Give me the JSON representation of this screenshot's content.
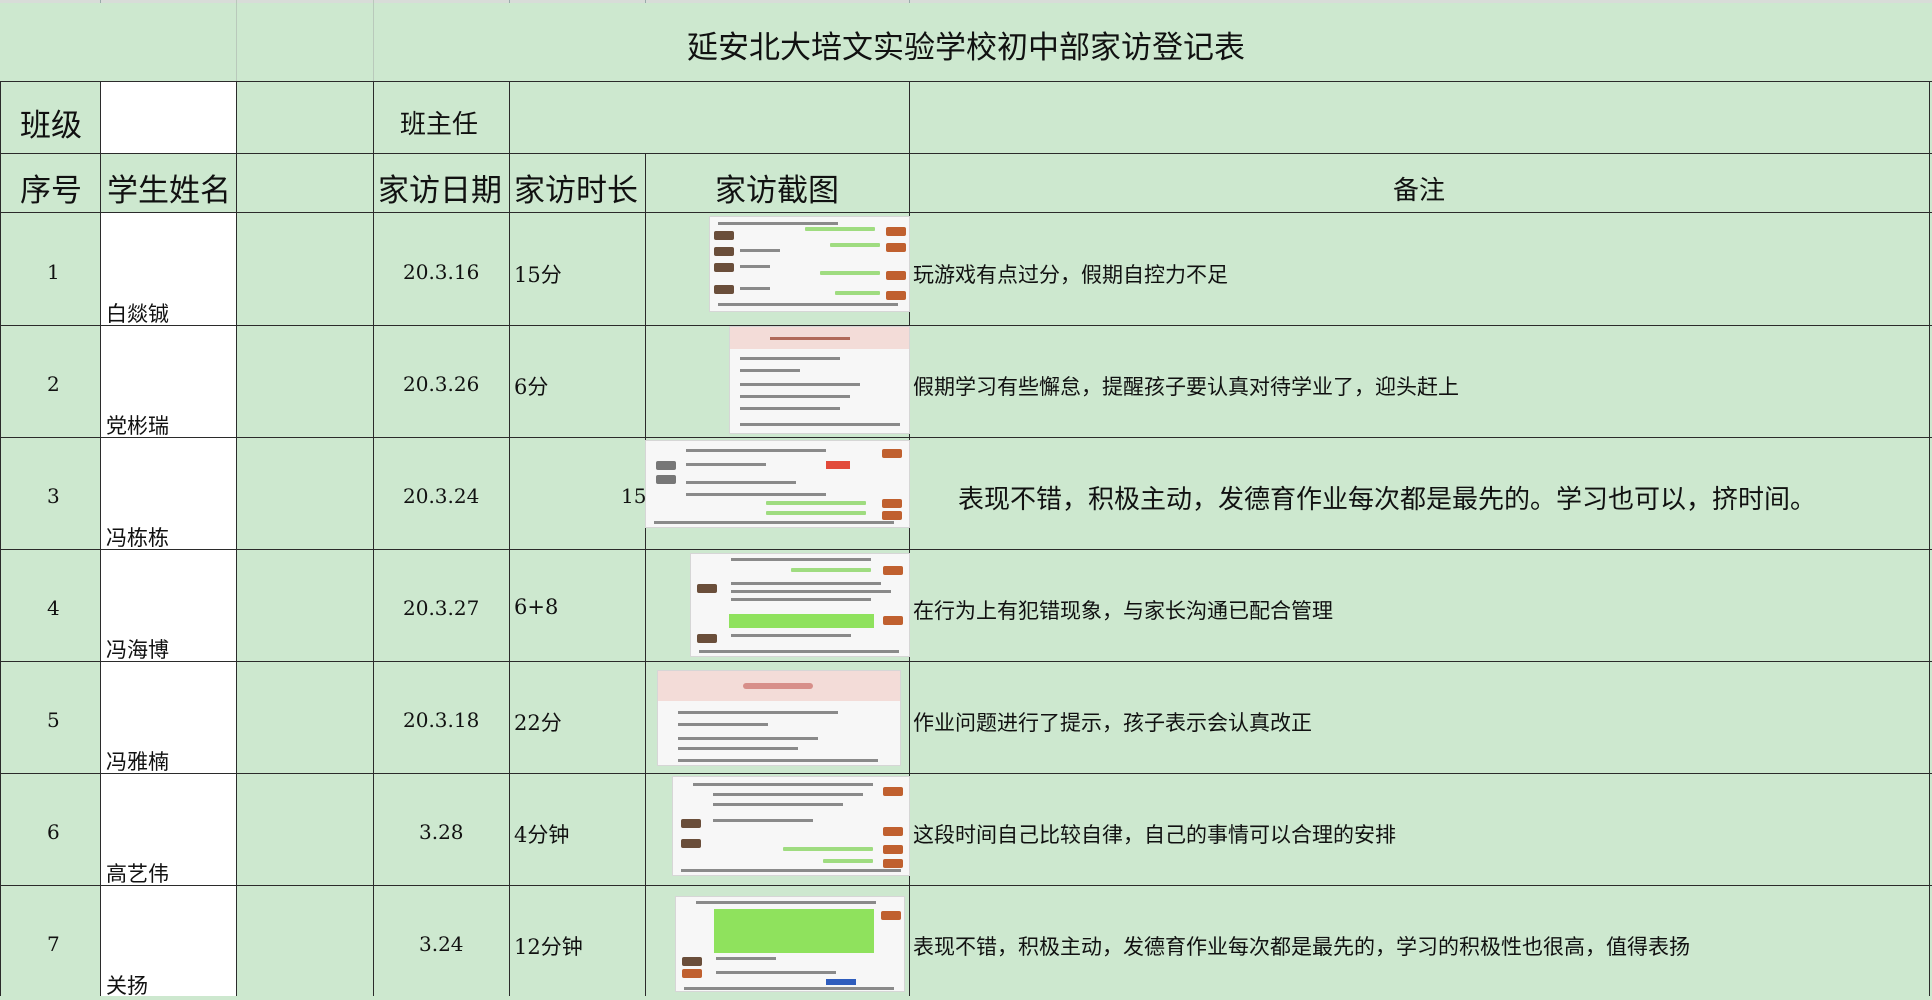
{
  "title": "延安北大培文实验学校初中部家访登记表",
  "header_row1": {
    "class_label": "班级",
    "class_value": "",
    "teacher_label": "班主任",
    "teacher_value": ""
  },
  "columns": {
    "index": "序号",
    "name": "学生姓名",
    "date": "家访日期",
    "duration": "家访时长",
    "screenshot": "家访截图",
    "notes": "备注"
  },
  "rows": [
    {
      "index": "1",
      "name": "白燚铖",
      "date": "20.3.16",
      "duration": "15分",
      "duration_extra": "",
      "note": "玩游戏有点过分，假期自控力不足"
    },
    {
      "index": "2",
      "name": "党彬瑞",
      "date": "20.3.26",
      "duration": "6分",
      "duration_extra": "",
      "note": "假期学习有些懈怠，提醒孩子要认真对待学业了，迎头赶上"
    },
    {
      "index": "3",
      "name": "冯栋栋",
      "date": "20.3.24",
      "duration": "",
      "duration_extra": "15",
      "note": "表现不错，积极主动，发德育作业每次都是最先的。学习也可以，挤时间。"
    },
    {
      "index": "4",
      "name": "冯海博",
      "date": "20.3.27",
      "duration": "6+8",
      "duration_extra": "",
      "note": "在行为上有犯错现象，与家长沟通已配合管理"
    },
    {
      "index": "5",
      "name": "冯雅楠",
      "date": "20.3.18",
      "duration": "22分",
      "duration_extra": "",
      "note": "作业问题进行了提示，孩子表示会认真改正"
    },
    {
      "index": "6",
      "name": "高艺伟",
      "date": "3.28",
      "duration": "4分钟",
      "duration_extra": "",
      "note": "这段时间自己比较自律，自己的事情可以合理的安排"
    },
    {
      "index": "7",
      "name": "关扬",
      "date": "3.24",
      "duration": "12分钟",
      "duration_extra": "",
      "note": "表现不错，积极主动，发德育作业每次都是最先的，学习的积极性也很高，值得表扬"
    }
  ],
  "colors": {
    "sheet_bg": "#cde8cf",
    "grid": "#2b2b2b",
    "name_cells": "#ffffff",
    "chat_green": "#9fdc80"
  }
}
